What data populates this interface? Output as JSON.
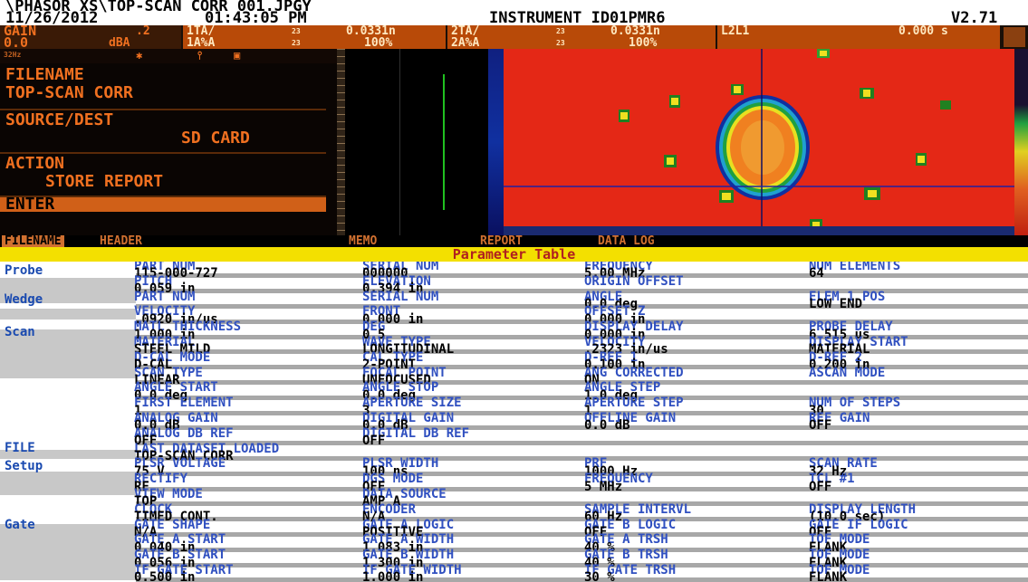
{
  "header": {
    "path": "\\PHASOR XS\\TOP-SCAN CORR 001.JPGY",
    "date": "11/26/2012",
    "time": "01:43:05 PM",
    "instrument": "INSTRUMENT ID01PMR6",
    "version": "V2.71"
  },
  "gain_bar": {
    "gain_label": "GAIN",
    "gain_step": ".2",
    "gain_value": "0.0",
    "gain_unit": "dBA",
    "readings": [
      {
        "label": "1TA/",
        "superscript": "23",
        "value": "0.0331n"
      },
      {
        "label": "2TA/",
        "superscript": "23",
        "value": "0.0331n"
      },
      {
        "label": "L2L1",
        "superscript": "",
        "value": "0.000 s"
      }
    ],
    "readings_row2": [
      {
        "label": "1A%A",
        "superscript": "23",
        "value": "100%"
      },
      {
        "label": "2A%A",
        "superscript": "23",
        "value": "100%"
      }
    ],
    "freq_badge": "32Hz"
  },
  "left_menu": {
    "items": [
      {
        "title": "FILENAME",
        "value": "TOP-SCAN CORR"
      },
      {
        "title": "SOURCE/DEST",
        "value": "SD CARD"
      },
      {
        "title": "ACTION",
        "value": "STORE REPORT"
      },
      {
        "title": "ENTER",
        "value": ""
      }
    ]
  },
  "tabs": [
    "FILENAME",
    "HEADER",
    "MEMO",
    "REPORT",
    "DATA LOG"
  ],
  "param_title": "Parameter Table",
  "sections": [
    "Probe",
    "Wedge",
    "Scan",
    "FILE",
    "Setup",
    "Gate"
  ],
  "rows": [
    {
      "c1": "PART NUM",
      "c2": "SERIAL NUM",
      "c3": "FREQUENCY",
      "c4": "NUM ELEMENTS",
      "type": "lbl"
    },
    {
      "c1": "115-000-727",
      "c2": "000000",
      "c3": "5.00 MHz",
      "c4": "64",
      "type": "val"
    },
    {
      "c1": "PITCH",
      "c2": "ELEVATION",
      "c3": "ORIGIN OFFSET",
      "c4": "",
      "type": "lbl"
    },
    {
      "c1": "0.059 in",
      "c2": "0.394 in",
      "c3": "",
      "c4": "",
      "type": "val"
    },
    {
      "c1": "PART NUM",
      "c2": "SERIAL NUM",
      "c3": "ANGLE",
      "c4": "ELEM 1 POS",
      "type": "lbl"
    },
    {
      "c1": "",
      "c2": "",
      "c3": "0.0 deg",
      "c4": "LOW END",
      "type": "val"
    },
    {
      "c1": "VELOCITY",
      "c2": "FRONT",
      "c3": "OFFSET Z",
      "c4": "",
      "type": "lbl"
    },
    {
      "c1": ".0920 in/us",
      "c2": "0.000 in",
      "c3": "0.000 in",
      "c4": "",
      "type": "val"
    },
    {
      "c1": "MATL THICKNESS",
      "c2": "DEG",
      "c3": "DISPLAY DELAY",
      "c4": "PROBE DELAY",
      "type": "lbl"
    },
    {
      "c1": "1.000 in",
      "c2": "0.5",
      "c3": "0.000 in",
      "c4": "6.515 us",
      "type": "val"
    },
    {
      "c1": "MATERIAL",
      "c2": "WAVE TYPE",
      "c3": "VELOCITY",
      "c4": "DISPLAY START",
      "type": "lbl"
    },
    {
      "c1": "STEEL MILD",
      "c2": "LONGITUDINAL",
      "c3": ".2323 in/us",
      "c4": "MATERIAL",
      "type": "val"
    },
    {
      "c1": "D-CAL MODE",
      "c2": "CAL TYPE",
      "c3": "D-REF 1",
      "c4": "D-REF 2",
      "type": "lbl"
    },
    {
      "c1": "D-CAL",
      "c2": "2-POINT",
      "c3": "0.100 in",
      "c4": "0.200 in",
      "type": "val"
    },
    {
      "c1": "SCAN TYPE",
      "c2": "FOCAL POINT",
      "c3": "ANG CORRECTED",
      "c4": "ASCAN MODE",
      "type": "lbl"
    },
    {
      "c1": "LINEAR",
      "c2": "UNFOCUSED",
      "c3": "ON",
      "c4": "",
      "type": "val"
    },
    {
      "c1": "ANGLE START",
      "c2": "ANGLE STOP",
      "c3": "ANGLE STEP",
      "c4": "",
      "type": "lbl"
    },
    {
      "c1": "0.0 deg",
      "c2": "0.0 deg",
      "c3": "1.0 deg",
      "c4": "",
      "type": "val"
    },
    {
      "c1": "FIRST ELEMENT",
      "c2": "APERTURE SIZE",
      "c3": "APERTURE STEP",
      "c4": "NUM OF STEPS",
      "type": "lbl"
    },
    {
      "c1": "1",
      "c2": "3",
      "c3": "1",
      "c4": "30",
      "type": "val"
    },
    {
      "c1": "ANALOG GAIN",
      "c2": "DIGITAL GAIN",
      "c3": "OFFLINE GAIN",
      "c4": "REF GAIN",
      "type": "lbl"
    },
    {
      "c1": "0.0 dB",
      "c2": "0.0 dB",
      "c3": "0.0 dB",
      "c4": "OFF",
      "type": "val"
    },
    {
      "c1": "ANALOG DB REF",
      "c2": "DIGITAL DB REF",
      "c3": "",
      "c4": "",
      "type": "lbl"
    },
    {
      "c1": "OFF",
      "c2": "OFF",
      "c3": "",
      "c4": "",
      "type": "val"
    },
    {
      "c1": "LAST DATASET LOADED",
      "c2": "",
      "c3": "",
      "c4": "",
      "type": "lbl"
    },
    {
      "c1": "TOP-SCAN CORR",
      "c2": "",
      "c3": "",
      "c4": "",
      "type": "val"
    },
    {
      "c1": "PLSR VOLTAGE",
      "c2": "PLSR WIDTH",
      "c3": "PRF",
      "c4": "SCAN RATE",
      "type": "lbl"
    },
    {
      "c1": "75 V",
      "c2": "100 ns",
      "c3": "1000 Hz",
      "c4": "32 Hz",
      "type": "val"
    },
    {
      "c1": "RECTIFY",
      "c2": "DGS MODE",
      "c3": "FREQUENCY",
      "c4": "TCL #1",
      "type": "lbl"
    },
    {
      "c1": "RF",
      "c2": "OFF",
      "c3": "5 MHz",
      "c4": "OFF",
      "type": "val"
    },
    {
      "c1": "VIEW MODE",
      "c2": "DATA SOURCE",
      "c3": "",
      "c4": "",
      "type": "lbl"
    },
    {
      "c1": "TOP",
      "c2": "AMP A",
      "c3": "",
      "c4": "",
      "type": "val"
    },
    {
      "c1": "CLOCK",
      "c2": "ENCODER",
      "c3": "SAMPLE INTERVL",
      "c4": "DISPLAY LENGTH",
      "type": "lbl"
    },
    {
      "c1": "TIMED CONT.",
      "c2": "N/A",
      "c3": "60 Hz",
      "c4": "(10.0 sec)",
      "type": "val"
    },
    {
      "c1": "GATE SHAPE",
      "c2": "GATE A LOGIC",
      "c3": "GATE B LOGIC",
      "c4": "GATE IF LOGIC",
      "type": "lbl"
    },
    {
      "c1": "N/A",
      "c2": "POSITIVE",
      "c3": "OFF",
      "c4": "OFF",
      "type": "val"
    },
    {
      "c1": "GATE A START",
      "c2": "GATE A WIDTH",
      "c3": "GATE A TRSH",
      "c4": "TOF MODE",
      "type": "lbl"
    },
    {
      "c1": "0.040 in",
      "c2": "1.083 in",
      "c3": "40 %",
      "c4": "FLANK",
      "type": "val"
    },
    {
      "c1": "GATE B START",
      "c2": "GATE B WIDTH",
      "c3": "GATE B TRSH",
      "c4": "TOF MODE",
      "type": "lbl"
    },
    {
      "c1": "0.056 in",
      "c2": "1.300 in",
      "c3": "40 %",
      "c4": "FLANK",
      "type": "val"
    },
    {
      "c1": "IF GATE START",
      "c2": "IF GATE WIDTH",
      "c3": "IF GATE TRSH",
      "c4": "TOF MODE",
      "type": "lbl"
    },
    {
      "c1": "0.500 in",
      "c2": "1.000 in",
      "c3": "30 %",
      "c4": "FLANK",
      "type": "val"
    }
  ]
}
